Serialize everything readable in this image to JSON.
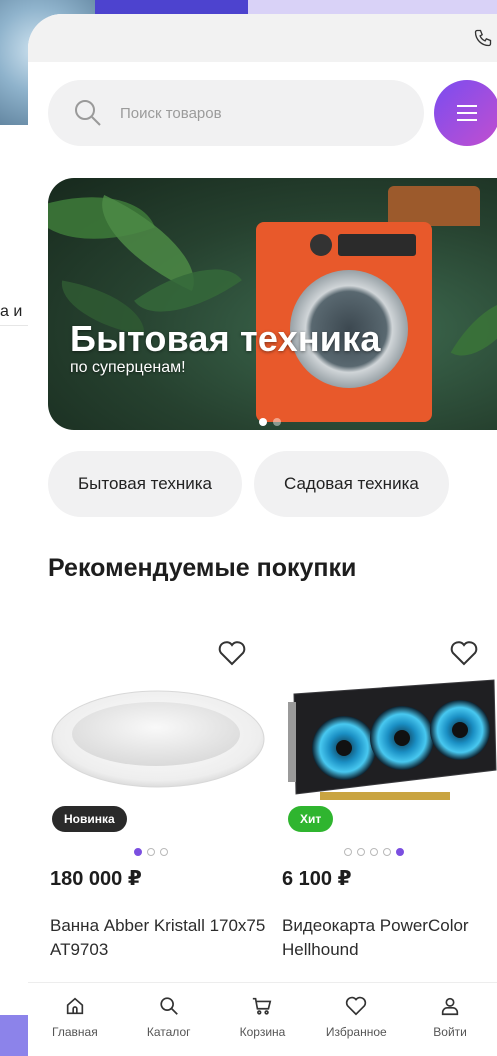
{
  "background": {
    "side_text": "а и"
  },
  "search": {
    "placeholder": "Поиск товаров"
  },
  "banner": {
    "title": "Бытовая техника",
    "subtitle": "по суперценам!",
    "slides": 2,
    "active_slide": 1
  },
  "chips": [
    {
      "label": "Бытовая техника"
    },
    {
      "label": "Садовая техника"
    }
  ],
  "section": {
    "title": "Рекомендуемые покупки"
  },
  "products": [
    {
      "badge": "Новинка",
      "price": "180 000 ₽",
      "name": "Ванна Abber Kristall 170x75 AT9703",
      "image_dots": 3,
      "active_dot": 1,
      "image": "bathtub"
    },
    {
      "badge": "Хит",
      "price": "6 100 ₽",
      "name": "Видеокарта PowerColor Hellhound",
      "image_dots": 5,
      "active_dot": 5,
      "image": "graphics-card"
    }
  ],
  "bottom_nav": [
    {
      "label": "Главная",
      "icon": "home-icon"
    },
    {
      "label": "Каталог",
      "icon": "search-icon"
    },
    {
      "label": "Корзина",
      "icon": "cart-icon"
    },
    {
      "label": "Избранное",
      "icon": "heart-icon"
    },
    {
      "label": "Войти",
      "icon": "user-icon"
    }
  ],
  "colors": {
    "accent": "#7b4fe0",
    "menu_gradient_start": "#7a4df0",
    "menu_gradient_end": "#c24ecf",
    "badge_new": "#2a2a2a",
    "badge_hit": "#2fb52f"
  }
}
